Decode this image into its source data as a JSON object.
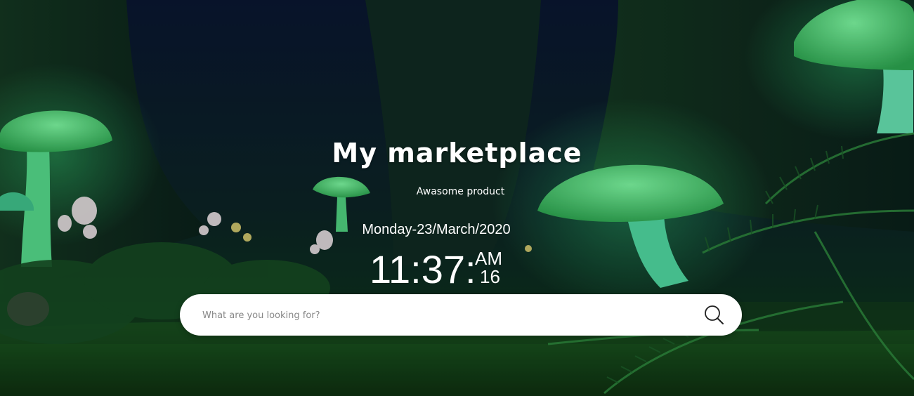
{
  "header": {
    "title": "My marketplace",
    "subtitle": "Awasome product"
  },
  "clock": {
    "date": "Monday-23/March/2020",
    "time": "11:37:",
    "ampm": "AM",
    "seconds": "16"
  },
  "search": {
    "placeholder": "What are you looking for?",
    "value": ""
  },
  "icons": {
    "search": "search-icon"
  },
  "colors": {
    "text": "#ffffff",
    "search_bg": "#ffffff",
    "glow_green": "#4fe07a"
  }
}
